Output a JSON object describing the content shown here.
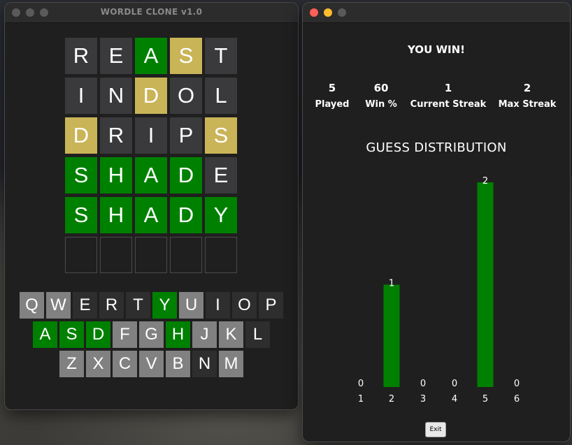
{
  "left_window": {
    "title": "WORDLE CLONE v1.0",
    "board": [
      [
        {
          "l": "R",
          "s": "gray"
        },
        {
          "l": "E",
          "s": "gray"
        },
        {
          "l": "A",
          "s": "green"
        },
        {
          "l": "S",
          "s": "yellow"
        },
        {
          "l": "T",
          "s": "gray"
        }
      ],
      [
        {
          "l": "I",
          "s": "gray"
        },
        {
          "l": "N",
          "s": "gray"
        },
        {
          "l": "D",
          "s": "yellow"
        },
        {
          "l": "O",
          "s": "gray"
        },
        {
          "l": "L",
          "s": "gray"
        }
      ],
      [
        {
          "l": "D",
          "s": "yellow"
        },
        {
          "l": "R",
          "s": "gray"
        },
        {
          "l": "I",
          "s": "gray"
        },
        {
          "l": "P",
          "s": "gray"
        },
        {
          "l": "S",
          "s": "yellow"
        }
      ],
      [
        {
          "l": "S",
          "s": "green"
        },
        {
          "l": "H",
          "s": "green"
        },
        {
          "l": "A",
          "s": "green"
        },
        {
          "l": "D",
          "s": "green"
        },
        {
          "l": "E",
          "s": "gray"
        }
      ],
      [
        {
          "l": "S",
          "s": "green"
        },
        {
          "l": "H",
          "s": "green"
        },
        {
          "l": "A",
          "s": "green"
        },
        {
          "l": "D",
          "s": "green"
        },
        {
          "l": "Y",
          "s": "green"
        }
      ],
      [
        {
          "l": "",
          "s": "empty"
        },
        {
          "l": "",
          "s": "empty"
        },
        {
          "l": "",
          "s": "empty"
        },
        {
          "l": "",
          "s": "empty"
        },
        {
          "l": "",
          "s": "empty"
        }
      ]
    ],
    "keyboard": [
      [
        {
          "k": "Q",
          "s": "light"
        },
        {
          "k": "W",
          "s": "light"
        },
        {
          "k": "E",
          "s": "dark"
        },
        {
          "k": "R",
          "s": "dark"
        },
        {
          "k": "T",
          "s": "dark"
        },
        {
          "k": "Y",
          "s": "green"
        },
        {
          "k": "U",
          "s": "light"
        },
        {
          "k": "I",
          "s": "dark"
        },
        {
          "k": "O",
          "s": "dark"
        },
        {
          "k": "P",
          "s": "dark"
        }
      ],
      [
        {
          "k": "A",
          "s": "green"
        },
        {
          "k": "S",
          "s": "green"
        },
        {
          "k": "D",
          "s": "green"
        },
        {
          "k": "F",
          "s": "light"
        },
        {
          "k": "G",
          "s": "light"
        },
        {
          "k": "H",
          "s": "green"
        },
        {
          "k": "J",
          "s": "light"
        },
        {
          "k": "K",
          "s": "light"
        },
        {
          "k": "L",
          "s": "dark"
        }
      ],
      [
        {
          "k": "Z",
          "s": "light"
        },
        {
          "k": "X",
          "s": "light"
        },
        {
          "k": "C",
          "s": "light"
        },
        {
          "k": "V",
          "s": "light"
        },
        {
          "k": "B",
          "s": "light"
        },
        {
          "k": "N",
          "s": "dark"
        },
        {
          "k": "M",
          "s": "light"
        }
      ]
    ]
  },
  "right_window": {
    "message": "YOU WIN!",
    "stats": [
      {
        "value": "5",
        "label": "Played"
      },
      {
        "value": "60",
        "label": "Win %"
      },
      {
        "value": "1",
        "label": "Current Streak"
      },
      {
        "value": "2",
        "label": "Max Streak"
      }
    ],
    "distribution_title": "GUESS DISTRIBUTION",
    "exit_label": "Exit"
  },
  "chart_data": {
    "type": "bar",
    "categories": [
      "1",
      "2",
      "3",
      "4",
      "5",
      "6"
    ],
    "values": [
      0,
      1,
      0,
      0,
      2,
      0
    ],
    "title": "GUESS DISTRIBUTION",
    "bar_color": "#008000",
    "label_color": "#ffffff"
  },
  "colors": {
    "green": "#008000",
    "yellow": "#c9b458",
    "gray_tile": "#3a3a3c",
    "key_light": "#818181",
    "key_dark": "#2e2e2e",
    "traffic_red": "#ff5f57",
    "traffic_yellow": "#febc2e",
    "traffic_green": "#28c840",
    "traffic_inactive": "#5a5a5a"
  }
}
